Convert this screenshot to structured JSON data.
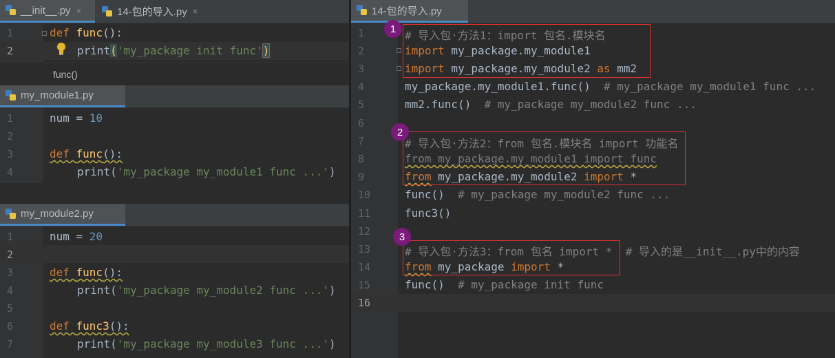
{
  "left_top": {
    "tabs": [
      {
        "label": "__init__.py",
        "close": "×"
      },
      {
        "label": "14-包的导入.py",
        "close": "×"
      }
    ],
    "lines": [
      {
        "n": "1",
        "tokens": [
          {
            "t": "def ",
            "c": "kw"
          },
          {
            "t": "func",
            "c": "fn"
          },
          {
            "t": "():",
            "c": ""
          }
        ]
      },
      {
        "n": "2",
        "tokens": [
          {
            "t": "print",
            "c": ""
          },
          {
            "t": "(",
            "c": "fn"
          },
          {
            "t": "'my_package init func'",
            "c": "str"
          },
          {
            "t": ")",
            "c": "fn"
          }
        ]
      }
    ],
    "breadcrumb": "func()"
  },
  "left_mid": {
    "tab": "my_module1.py",
    "lines": [
      {
        "n": "1",
        "text": "num = ",
        "num": "10"
      },
      {
        "n": "2",
        "text": ""
      },
      {
        "n": "3",
        "kw": "def ",
        "fn": "func",
        "rest": "():"
      },
      {
        "n": "4",
        "pre": "print(",
        "str": "'my_package my_module1 func ...'",
        "post": ")"
      }
    ]
  },
  "left_bot": {
    "tab": "my_module2.py",
    "lines": [
      {
        "n": "1",
        "text": "num = ",
        "num": "20"
      },
      {
        "n": "2",
        "text": ""
      },
      {
        "n": "3",
        "kw": "def ",
        "fn": "func",
        "rest": "():"
      },
      {
        "n": "4",
        "pre": "print(",
        "str": "'my_package my_module2 func ...'",
        "post": ")"
      },
      {
        "n": "5",
        "text": ""
      },
      {
        "n": "6",
        "kw": "def ",
        "fn": "func3",
        "rest": "():"
      },
      {
        "n": "7",
        "pre": "print(",
        "str": "'my_package my_module3 func ...'",
        "post": ")"
      }
    ]
  },
  "right": {
    "tab": "14-包的导入.py",
    "line_numbers": [
      "1",
      "2",
      "3",
      "4",
      "5",
      "6",
      "7",
      "8",
      "9",
      "10",
      "11",
      "12",
      "13",
      "14",
      "15",
      "16"
    ],
    "l1": "# 导入包·方法1：import 包名.模块名",
    "l2_kw": "import",
    "l2_rest": " my_package.my_module1",
    "l3_kw": "import",
    "l3_mid": " my_package.my_module2 ",
    "l3_as": "as",
    "l3_end": " mm2",
    "l4_code": "my_package.my_module1.func()",
    "l4_cmt": "  # my_package my_module1 func ...",
    "l5_code": "mm2.func()",
    "l5_cmt": "  # my_package my_module2 func ...",
    "l7": "# 导入包·方法2：from 包名.模块名 import 功能名",
    "l8": "from my_package.my_module1 import func",
    "l9_from": "from",
    "l9_mid": " my_package.my_module2 ",
    "l9_imp": "import",
    "l9_end": " *",
    "l10_code": "func()",
    "l10_cmt": "  # my_package my_module2 func ...",
    "l11": "func3()",
    "l13": "# 导入包·方法3：from 包名 import *",
    "l13_cmt": "  # 导入的是__init__.py中的内容",
    "l14_from": "from",
    "l14_mid": " my_package ",
    "l14_imp": "import",
    "l14_end": " *",
    "l15_code": "func()",
    "l15_cmt": "  # my_package init func",
    "badges": [
      "1",
      "2",
      "3"
    ]
  },
  "colors": {
    "keyword": "#cc7832",
    "function": "#ffc66d",
    "string": "#6a8759",
    "number": "#6897bb",
    "comment": "#808080",
    "annotation_box": "#e03030",
    "badge": "#7a1a7a"
  }
}
